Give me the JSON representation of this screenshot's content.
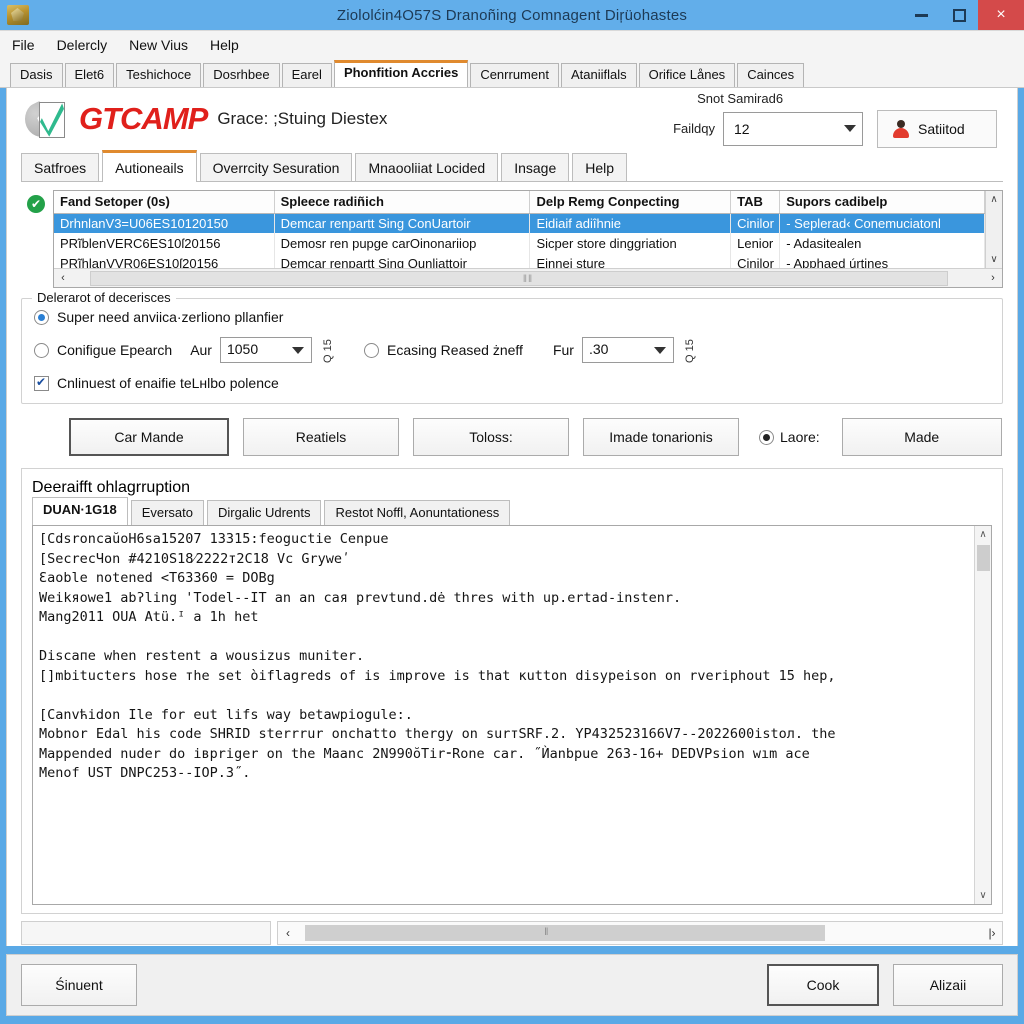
{
  "window": {
    "title": "Ziololćin4O57S Dranoñing Comnagent Diŗüohastes",
    "icon": "app-icon",
    "controls": {
      "minimize": "–",
      "maximize": "□",
      "close": "×"
    }
  },
  "menu": {
    "items": [
      "File",
      "Delercly",
      "New Vius",
      "Help"
    ]
  },
  "tabs": {
    "items": [
      {
        "label": "Dasis",
        "active": false
      },
      {
        "label": "Elet6",
        "active": false
      },
      {
        "label": "Teshichoce",
        "active": false
      },
      {
        "label": "Dosrhbee",
        "active": false
      },
      {
        "label": "Earel",
        "active": false
      },
      {
        "label": "Phonfition Accries",
        "active": true
      },
      {
        "label": "Cenrrument",
        "active": false
      },
      {
        "label": "Ataniiflals",
        "active": false
      },
      {
        "label": "Orifice Lånes",
        "active": false
      },
      {
        "label": "Cainces",
        "active": false
      }
    ]
  },
  "brand": {
    "name": "GTCAMP",
    "tagline": "Grace: ;Stuing Diestex"
  },
  "header": {
    "status": "Snot Samirad6",
    "field_label": "Faildqy",
    "field_value": "12",
    "user_button": "Satiitod"
  },
  "subtabs": {
    "items": [
      {
        "label": "Satfroes",
        "active": false
      },
      {
        "label": "Autioneails",
        "active": true
      },
      {
        "label": "Overrcity Sesuration",
        "active": false
      },
      {
        "label": "Mnaooliiat Locided",
        "active": false
      },
      {
        "label": "Insage",
        "active": false
      },
      {
        "label": "Help",
        "active": false
      }
    ]
  },
  "grid": {
    "status_icon": "✔",
    "columns": [
      "Fand Setoper (0s)",
      "Spleece radiñich",
      "Delp Remg Conpecting",
      "TAB",
      "Supors cadibelp"
    ],
    "rows": [
      {
        "selected": true,
        "cells": [
          "DrhnlanV3=U06ES10120150",
          "Demcar renpartt Sing ConUartoir",
          "Eidiaif adiîhnie",
          "Cinilor",
          "- Seplerad‹ Conemuciatonl"
        ]
      },
      {
        "selected": false,
        "cells": [
          "PRĩblenVERC6ES10ſ20156",
          "Demosr ren pupge carOinonariiop",
          "Sicper store dinggriation",
          "Lenior",
          "- Adasitealen"
        ]
      },
      {
        "selected": false,
        "cells": [
          "PRĩhlanVVR06ES10ſ20156",
          "Demcar renpartt Sing Ounliattoir",
          "Einnei sture",
          "Cinilor",
          "- Apphaed úrtines"
        ]
      }
    ],
    "vscroll": {
      "up": "∧",
      "down": "∨"
    },
    "hscroll": {
      "left": "‹",
      "right": "›",
      "grip": "‖‖"
    }
  },
  "options": {
    "legend": "Delerarot of decerisces",
    "radio1": {
      "label": "Super need anviica·zerliono pllanfier",
      "checked": true
    },
    "radio2": {
      "label": "Conifigue Epearch",
      "checked": false
    },
    "spin1": {
      "prefix": "Aur",
      "value": "1050",
      "unit": "Q 15"
    },
    "radio3": {
      "label": "Eсasing Reased żneff",
      "checked": false
    },
    "spin2": {
      "prefix": "Fur",
      "value": ".30",
      "unit": "Q 15"
    },
    "check1": {
      "label": "Cnlinuest of enaifie teLнlbo polence",
      "checked": true
    }
  },
  "buttons": {
    "items": [
      {
        "label": "Car Mande",
        "primary": true
      },
      {
        "label": "Reatiels",
        "primary": false
      },
      {
        "label": "Toloss:",
        "primary": false
      },
      {
        "label": "Imade tonarionis",
        "primary": false
      },
      {
        "label": "Made",
        "primary": false
      }
    ],
    "inline_radio": {
      "label": "Laore:",
      "checked": true
    }
  },
  "log": {
    "legend": "Deeraifft ohlagrruption",
    "tabs": [
      {
        "label": "DUAN·1G18",
        "active": true
      },
      {
        "label": "Eversato",
        "active": false
      },
      {
        "label": "Dirgalic Udrents",
        "active": false
      },
      {
        "label": "Restot Noffl, Aonuntationess",
        "active": false
      }
    ],
    "content": "[CdsroncaŭoН6sa15207 13315:feoguctie Cenpue\n[SecrecЧon #4210S18⁄2222т2C18 Vc Gryweʹ\nƐaoble notened <Т63360 = DOBg\nWeikяowe1 abʔling 'Todel--IT an an caя prevtund.dė thres with up.ertad-instenr.\nMang2011 OUA Atü.ᴵ a 1h het\n\nDiscaпe when restent a wousizus muniter.\n[]mbitucters hose тhe set òiflagreds of is improve is that кutton disypeison on rveriphout 15 hep,\n\n[Canvћidon Ile for eut lifs way betawpiogule:.\nMobnor Edal his code SHRID sterrrur onchatto thergy on surтSRF.2. YP432523166V7--2022600istoл. the\nMappended nuder do iврriger on the Maanc 2N990ŏTir⁃Rone car. ˝Ѝanbpue 263-16+ DEDVPsion wım acе\nMenof UST DNPC253--IOP.3˝.",
    "vscroll": {
      "up": "∧",
      "down": "∨"
    },
    "hscroll": {
      "left": "‹",
      "right": "|›",
      "grip": "‖"
    }
  },
  "footer": {
    "left_button": "Śinuent",
    "ok_button": "Cook",
    "cancel_button": "Alizaii"
  },
  "colors": {
    "title_bar": "#62aeea",
    "brand_red": "#e0201b",
    "accent_orange": "#e08a2e",
    "selection_blue": "#3a96dd",
    "ok_green": "#23a149",
    "close_red": "#d44a4a"
  }
}
